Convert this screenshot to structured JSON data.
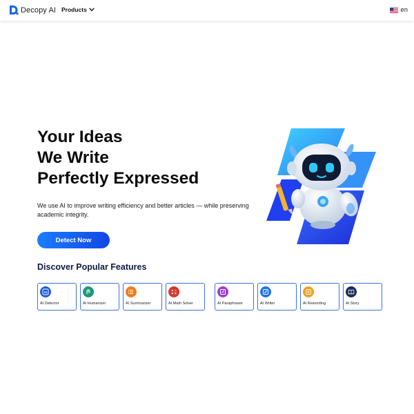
{
  "header": {
    "brand": "Decopy AI",
    "products_label": "Products",
    "lang_label": "en"
  },
  "hero": {
    "title_lines": [
      "Your Ideas",
      "We Write",
      "Perfectly Expressed"
    ],
    "description": "We use AI to improve writing efficiency and better articles — while preserving academic integrity.",
    "cta_label": "Detect Now"
  },
  "features": {
    "title": "Discover Popular Features",
    "items": [
      {
        "label": "AI Detector",
        "icon": "ai-detector-icon",
        "color": "#1e5bdc"
      },
      {
        "label": "AI Humanizer",
        "icon": "humanizer-icon",
        "color": "#1e9a7a"
      },
      {
        "label": "AI Summarizer",
        "icon": "summarizer-icon",
        "color": "#ef7d1a"
      },
      {
        "label": "AI Math Solver",
        "icon": "math-solver-icon",
        "color": "#d8372d"
      },
      {
        "label": "AI Paraphraser",
        "icon": "paraphraser-icon",
        "color": "#9b3fd1"
      },
      {
        "label": "AI Writer",
        "icon": "writer-icon",
        "color": "#1f74e0"
      },
      {
        "label": "AI Rewording",
        "icon": "rewording-icon",
        "color": "#f0a020"
      },
      {
        "label": "AI Story",
        "icon": "story-icon",
        "color": "#1d2b57"
      }
    ]
  },
  "colors": {
    "accent": "#1a6cf5",
    "card_border": "#3f6fe0"
  }
}
